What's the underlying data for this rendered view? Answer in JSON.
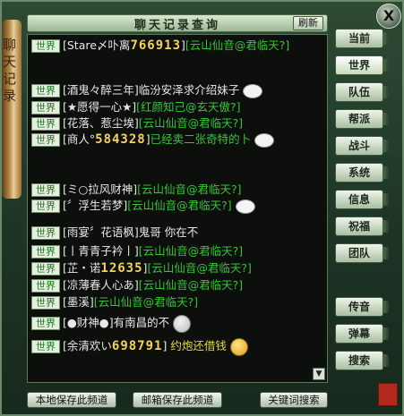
{
  "window": {
    "title": "聊天记录查询",
    "refresh_label": "刷新",
    "close_label": "X",
    "scroll_text": "聊天记录"
  },
  "channel_tag": "世界",
  "messages": [
    {
      "name": "[Stare〆卟离",
      "score": "766913",
      "suffix": "]",
      "text": "[云山仙音@君临天?]"
    },
    {
      "name": "[酒鬼々醉三年]",
      "text": "临汾安泽求介绍妹子"
    },
    {
      "name": "[★愿得一心★]",
      "text": "[红颜知己@玄天傲?]"
    },
    {
      "name": "[花落、惹尘埃]",
      "text": "[云山仙音@君临天?]"
    },
    {
      "name": "[商人°",
      "score": "584328",
      "suffix": "]",
      "text": "已经卖二张奇特的卜"
    },
    {
      "name": "[ミ○拉风财神]",
      "text": "[云山仙音@君临天?]"
    },
    {
      "name": "[〞浮生若梦]",
      "text": "[云山仙音@君临天?]"
    },
    {
      "name": "[雨宴〞花语枫]",
      "text": "鬼哥  你在不"
    },
    {
      "name": "[丨青青子衿丨]",
      "text": "[云山仙音@君临天?]"
    },
    {
      "name": "[芷・诺",
      "score": "12635",
      "suffix": "]",
      "text": "[云山仙音@君临天?]"
    },
    {
      "name": "[凉薄春人心あ]",
      "text": "[云山仙音@君临天?]"
    },
    {
      "name": "[墨溪]",
      "text": "[云山仙音@君临天?]"
    },
    {
      "name": "[●财神●]",
      "text": "有南昌的不"
    },
    {
      "name": "[余清欢い",
      "score": "698791",
      "suffix": "]",
      "text": "约炮还借钱"
    }
  ],
  "tabs": [
    "当前",
    "世界",
    "队伍",
    "帮派",
    "战斗",
    "系统",
    "信息",
    "祝福",
    "团队",
    "传音",
    "弹幕",
    "搜索"
  ],
  "active_tab": "世界",
  "bottom_buttons": {
    "save_local": "本地保存此频道",
    "save_mail": "邮箱保存此频道",
    "keyword_search": "关键词搜索"
  },
  "colors": {
    "channel_green": "#1e7a1e",
    "name_white": "#e8e8e8",
    "text_green": "#35c635",
    "score_gold": "#f5d35a",
    "text_yellow": "#e8d84a"
  },
  "icons": {
    "close": "close-icon",
    "scroll_down": "scroll-down-icon",
    "emote_bunny": "bunny-emote-icon",
    "emote_face": "face-emote-icon",
    "seal": "seal-icon"
  }
}
